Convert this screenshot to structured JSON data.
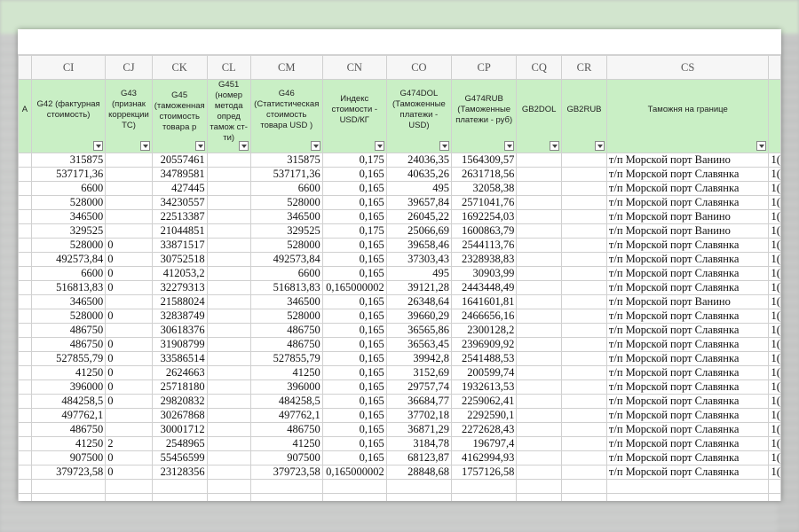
{
  "columns": [
    "CI",
    "CJ",
    "CK",
    "CL",
    "CM",
    "CN",
    "CO",
    "CP",
    "CQ",
    "CR",
    "CS"
  ],
  "headers": {
    "ci": "G42 (фактурная стоимость)",
    "cj": "G43 (признак коррекции ТС)",
    "ck": "G45 (таможенная стоимость товара р",
    "cl": "G451 (номер метода опред тамож ст-ти)",
    "cm": "G46 (Статистическая стоимость товара USD )",
    "cn": "Индекс стоимости - USD/КГ",
    "co": "G474DOL (Таможенные платежи - USD)",
    "cp": "G474RUB (Таможенные платежи - руб)",
    "cq": "GB2DOL",
    "cr": "GB2RUB",
    "cs": "Таможня на границе"
  },
  "left_stub": "A",
  "rows": [
    {
      "ci": "315875",
      "cj": "",
      "ck": "20557461",
      "cl": "",
      "cm": "315875",
      "cn": "0,175",
      "co": "24036,35",
      "cp": "1564309,57",
      "cq": "",
      "cr": "",
      "cs": "т/п Морской порт Ванино",
      "ct": "1("
    },
    {
      "ci": "537171,36",
      "cj": "",
      "ck": "34789581",
      "cl": "",
      "cm": "537171,36",
      "cn": "0,165",
      "co": "40635,26",
      "cp": "2631718,56",
      "cq": "",
      "cr": "",
      "cs": "т/п Морской порт Славянка",
      "ct": "1("
    },
    {
      "ci": "6600",
      "cj": "",
      "ck": "427445",
      "cl": "",
      "cm": "6600",
      "cn": "0,165",
      "co": "495",
      "cp": "32058,38",
      "cq": "",
      "cr": "",
      "cs": "т/п Морской порт Славянка",
      "ct": "1("
    },
    {
      "ci": "528000",
      "cj": "",
      "ck": "34230557",
      "cl": "",
      "cm": "528000",
      "cn": "0,165",
      "co": "39657,84",
      "cp": "2571041,76",
      "cq": "",
      "cr": "",
      "cs": "т/п Морской порт Славянка",
      "ct": "1("
    },
    {
      "ci": "346500",
      "cj": "",
      "ck": "22513387",
      "cl": "",
      "cm": "346500",
      "cn": "0,165",
      "co": "26045,22",
      "cp": "1692254,03",
      "cq": "",
      "cr": "",
      "cs": "т/п Морской порт Ванино",
      "ct": "1("
    },
    {
      "ci": "329525",
      "cj": "",
      "ck": "21044851",
      "cl": "",
      "cm": "329525",
      "cn": "0,175",
      "co": "25066,69",
      "cp": "1600863,79",
      "cq": "",
      "cr": "",
      "cs": "т/п Морской порт Ванино",
      "ct": "1("
    },
    {
      "ci": "528000",
      "cj": "0",
      "ck": "33871517",
      "cl": "",
      "cm": "528000",
      "cn": "0,165",
      "co": "39658,46",
      "cp": "2544113,76",
      "cq": "",
      "cr": "",
      "cs": "т/п Морской порт Славянка",
      "ct": "1("
    },
    {
      "ci": "492573,84",
      "cj": "0",
      "ck": "30752518",
      "cl": "",
      "cm": "492573,84",
      "cn": "0,165",
      "co": "37303,43",
      "cp": "2328938,83",
      "cq": "",
      "cr": "",
      "cs": "т/п Морской порт Славянка",
      "ct": "1("
    },
    {
      "ci": "6600",
      "cj": "0",
      "ck": "412053,2",
      "cl": "",
      "cm": "6600",
      "cn": "0,165",
      "co": "495",
      "cp": "30903,99",
      "cq": "",
      "cr": "",
      "cs": "т/п Морской порт Славянка",
      "ct": "1("
    },
    {
      "ci": "516813,83",
      "cj": "0",
      "ck": "32279313",
      "cl": "",
      "cm": "516813,83",
      "cn": "0,165000002",
      "co": "39121,28",
      "cp": "2443448,49",
      "cq": "",
      "cr": "",
      "cs": "т/п Морской порт Славянка",
      "ct": "1("
    },
    {
      "ci": "346500",
      "cj": "",
      "ck": "21588024",
      "cl": "",
      "cm": "346500",
      "cn": "0,165",
      "co": "26348,64",
      "cp": "1641601,81",
      "cq": "",
      "cr": "",
      "cs": "т/п Морской порт Ванино",
      "ct": "1("
    },
    {
      "ci": "528000",
      "cj": "0",
      "ck": "32838749",
      "cl": "",
      "cm": "528000",
      "cn": "0,165",
      "co": "39660,29",
      "cp": "2466656,16",
      "cq": "",
      "cr": "",
      "cs": "т/п Морской порт Славянка",
      "ct": "1("
    },
    {
      "ci": "486750",
      "cj": "",
      "ck": "30618376",
      "cl": "",
      "cm": "486750",
      "cn": "0,165",
      "co": "36565,86",
      "cp": "2300128,2",
      "cq": "",
      "cr": "",
      "cs": "т/п Морской порт Славянка",
      "ct": "1("
    },
    {
      "ci": "486750",
      "cj": "0",
      "ck": "31908799",
      "cl": "",
      "cm": "486750",
      "cn": "0,165",
      "co": "36563,45",
      "cp": "2396909,92",
      "cq": "",
      "cr": "",
      "cs": "т/п Морской порт Славянка",
      "ct": "1("
    },
    {
      "ci": "527855,79",
      "cj": "0",
      "ck": "33586514",
      "cl": "",
      "cm": "527855,79",
      "cn": "0,165",
      "co": "39942,8",
      "cp": "2541488,53",
      "cq": "",
      "cr": "",
      "cs": "т/п Морской порт Славянка",
      "ct": "1("
    },
    {
      "ci": "41250",
      "cj": "0",
      "ck": "2624663",
      "cl": "",
      "cm": "41250",
      "cn": "0,165",
      "co": "3152,69",
      "cp": "200599,74",
      "cq": "",
      "cr": "",
      "cs": "т/п Морской порт Славянка",
      "ct": "1("
    },
    {
      "ci": "396000",
      "cj": "0",
      "ck": "25718180",
      "cl": "",
      "cm": "396000",
      "cn": "0,165",
      "co": "29757,74",
      "cp": "1932613,53",
      "cq": "",
      "cr": "",
      "cs": "т/п Морской порт Славянка",
      "ct": "1("
    },
    {
      "ci": "484258,5",
      "cj": "0",
      "ck": "29820832",
      "cl": "",
      "cm": "484258,5",
      "cn": "0,165",
      "co": "36684,77",
      "cp": "2259062,41",
      "cq": "",
      "cr": "",
      "cs": "т/п Морской порт Славянка",
      "ct": "1("
    },
    {
      "ci": "497762,1",
      "cj": "",
      "ck": "30267868",
      "cl": "",
      "cm": "497762,1",
      "cn": "0,165",
      "co": "37702,18",
      "cp": "2292590,1",
      "cq": "",
      "cr": "",
      "cs": "т/п Морской порт Славянка",
      "ct": "1("
    },
    {
      "ci": "486750",
      "cj": "",
      "ck": "30001712",
      "cl": "",
      "cm": "486750",
      "cn": "0,165",
      "co": "36871,29",
      "cp": "2272628,43",
      "cq": "",
      "cr": "",
      "cs": "т/п Морской порт Славянка",
      "ct": "1("
    },
    {
      "ci": "41250",
      "cj": "2",
      "ck": "2548965",
      "cl": "",
      "cm": "41250",
      "cn": "0,165",
      "co": "3184,78",
      "cp": "196797,4",
      "cq": "",
      "cr": "",
      "cs": "т/п Морской порт Славянка",
      "ct": "1("
    },
    {
      "ci": "907500",
      "cj": "0",
      "ck": "55456599",
      "cl": "",
      "cm": "907500",
      "cn": "0,165",
      "co": "68123,87",
      "cp": "4162994,93",
      "cq": "",
      "cr": "",
      "cs": "т/п Морской порт Славянка",
      "ct": "1("
    },
    {
      "ci": "379723,58",
      "cj": "0",
      "ck": "23128356",
      "cl": "",
      "cm": "379723,58",
      "cn": "0,165000002",
      "co": "28848,68",
      "cp": "1757126,58",
      "cq": "",
      "cr": "",
      "cs": "т/п Морской порт Славянка",
      "ct": "1("
    }
  ]
}
